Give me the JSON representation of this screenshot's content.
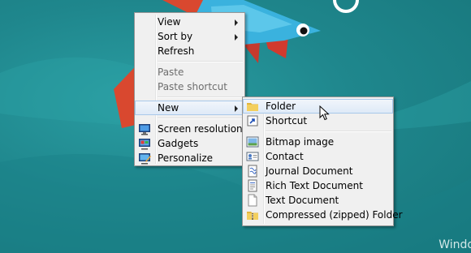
{
  "context_menu": {
    "items": [
      {
        "label": "View"
      },
      {
        "label": "Sort by"
      },
      {
        "label": "Refresh"
      },
      {
        "label": "Paste"
      },
      {
        "label": "Paste shortcut"
      },
      {
        "label": "New"
      },
      {
        "label": "Screen resolution",
        "icon": "screen-resolution-icon"
      },
      {
        "label": "Gadgets",
        "icon": "gadgets-icon"
      },
      {
        "label": "Personalize",
        "icon": "personalize-icon"
      }
    ]
  },
  "new_submenu": {
    "items": [
      {
        "label": "Folder",
        "icon": "folder-icon"
      },
      {
        "label": "Shortcut",
        "icon": "shortcut-icon"
      },
      {
        "label": "Bitmap image",
        "icon": "bitmap-icon"
      },
      {
        "label": "Contact",
        "icon": "contact-icon"
      },
      {
        "label": "Journal Document",
        "icon": "journal-icon"
      },
      {
        "label": "Rich Text Document",
        "icon": "rich-text-icon"
      },
      {
        "label": "Text Document",
        "icon": "text-document-icon"
      },
      {
        "label": "Compressed (zipped) Folder",
        "icon": "zip-folder-icon"
      }
    ]
  },
  "desktop": {
    "watermark": "Windo"
  }
}
